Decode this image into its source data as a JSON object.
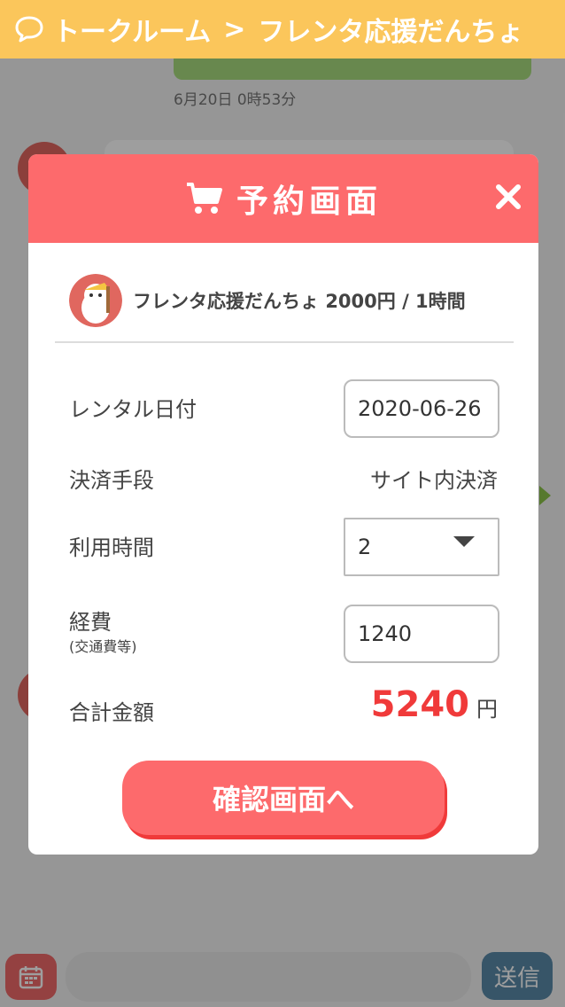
{
  "header": {
    "breadcrumb_root": "トークルーム",
    "separator": ">",
    "breadcrumb_current": "フレンタ応援だんちょ",
    "background_color": "#fbc65b",
    "icon": "chat-bubble-icon"
  },
  "chat": {
    "message_time": "6月20日 0時53分"
  },
  "modal": {
    "title": "予約画面",
    "title_icon": "cart-icon",
    "close_icon": "close-icon",
    "accent_color": "#fd6a6c",
    "host": {
      "name": "フレンタ応援だんちょ",
      "rate": "2000円 / 1時間"
    },
    "form": {
      "date_label": "レンタル日付",
      "date_value": "2020-06-26",
      "payment_label": "決済手段",
      "payment_value": "サイト内決済",
      "hours_label": "利用時間",
      "hours_value": "2",
      "expense_label": "経費",
      "expense_note": "(交通費等)",
      "expense_value": "1240",
      "total_label": "合計金額",
      "total_value": "5240",
      "total_unit": "円",
      "total_color": "#f03a3a"
    },
    "confirm_label": "確認画面へ"
  },
  "bottom_bar": {
    "calendar_icon": "calendar-icon",
    "send_label": "送信"
  }
}
